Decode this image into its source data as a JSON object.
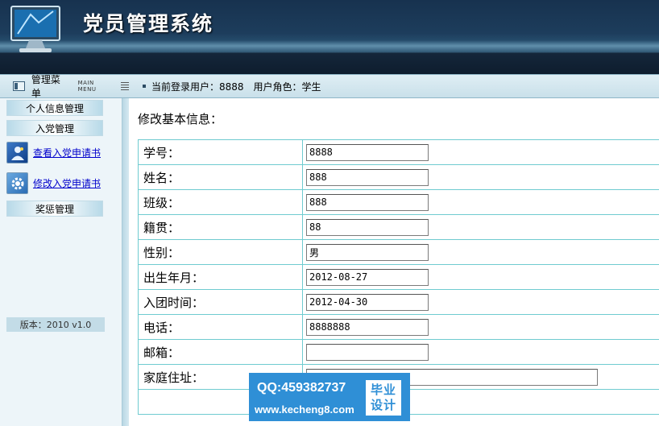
{
  "app": {
    "title": "党员管理系统"
  },
  "menu": {
    "title": "管理菜单",
    "subtitle": "MAIN MENU"
  },
  "user_bar": {
    "text": "当前登录用户：8888　用户角色：学生"
  },
  "sidebar": {
    "sections": [
      {
        "label": "个人信息管理"
      },
      {
        "label": "入党管理"
      },
      {
        "label": "奖惩管理"
      }
    ],
    "links": [
      {
        "label": "查看入党申请书",
        "icon": "person-icon"
      },
      {
        "label": "修改入党申请书",
        "icon": "gear-icon"
      }
    ],
    "version": "版本：2010 v1.0"
  },
  "form": {
    "title": "修改基本信息：",
    "fields": [
      {
        "label": "学号：",
        "value": "8888"
      },
      {
        "label": "姓名：",
        "value": "888"
      },
      {
        "label": "班级：",
        "value": "888"
      },
      {
        "label": "籍贯：",
        "value": "88"
      },
      {
        "label": "性别：",
        "value": "男"
      },
      {
        "label": "出生年月：",
        "value": "2012-08-27"
      },
      {
        "label": "入团时间：",
        "value": "2012-04-30"
      },
      {
        "label": "电话：",
        "value": "8888888"
      },
      {
        "label": "邮箱：",
        "value": ""
      },
      {
        "label": "家庭住址：",
        "value": ""
      }
    ]
  },
  "watermark": {
    "qq": "QQ:459382737",
    "url": "www.kecheng8.com",
    "badge_line1": "毕业",
    "badge_line2": "设计"
  },
  "colors": {
    "header_dark": "#17324f",
    "table_border": "#6fcbd0",
    "sidebar_bg": "#edf5f9",
    "link": "#0000cc",
    "watermark_bg": "#2f8fd6"
  }
}
